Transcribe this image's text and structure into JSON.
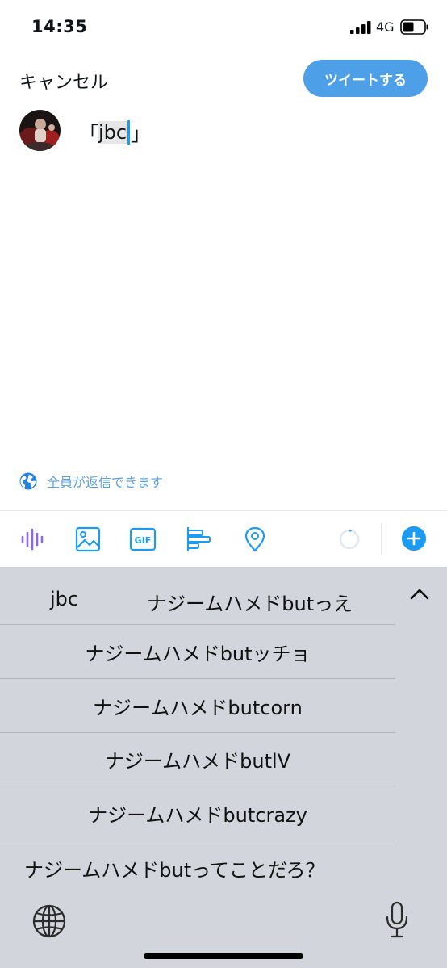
{
  "status_bar": {
    "time": "14:35",
    "network": "4G",
    "icons": [
      "signal-icon",
      "battery-icon"
    ]
  },
  "header": {
    "cancel_label": "キャンセル",
    "tweet_label": "ツイートする"
  },
  "compose": {
    "open_bracket": "「",
    "selected_text": "jbc",
    "close_bracket": "」"
  },
  "reply_setting": {
    "icon": "globe-icon",
    "label": "全員が返信できます"
  },
  "toolbar": {
    "icons": [
      "voice-icon",
      "image-icon",
      "gif-icon",
      "poll-icon",
      "location-icon",
      "char-count-ring",
      "add-tweet-icon"
    ],
    "gif_label": "GIF"
  },
  "keyboard": {
    "candidates_top": {
      "left": "jbc",
      "right": "ナジームハメドbutっえ"
    },
    "candidates": [
      "ナジームハメドbutッチョ",
      "ナジームハメドbutcorn",
      "ナジームハメドbutlV",
      "ナジームハメドbutcrazy",
      "ナジームハメドbutってことだろ？"
    ],
    "icons": [
      "chevron-up-icon",
      "globe-icon",
      "microphone-icon"
    ]
  },
  "colors": {
    "accent": "#1d9bf0",
    "tweet_button": "#4d9fe8",
    "voice_icon": "#8e66e8",
    "keyboard_bg": "#d2d5dc"
  }
}
